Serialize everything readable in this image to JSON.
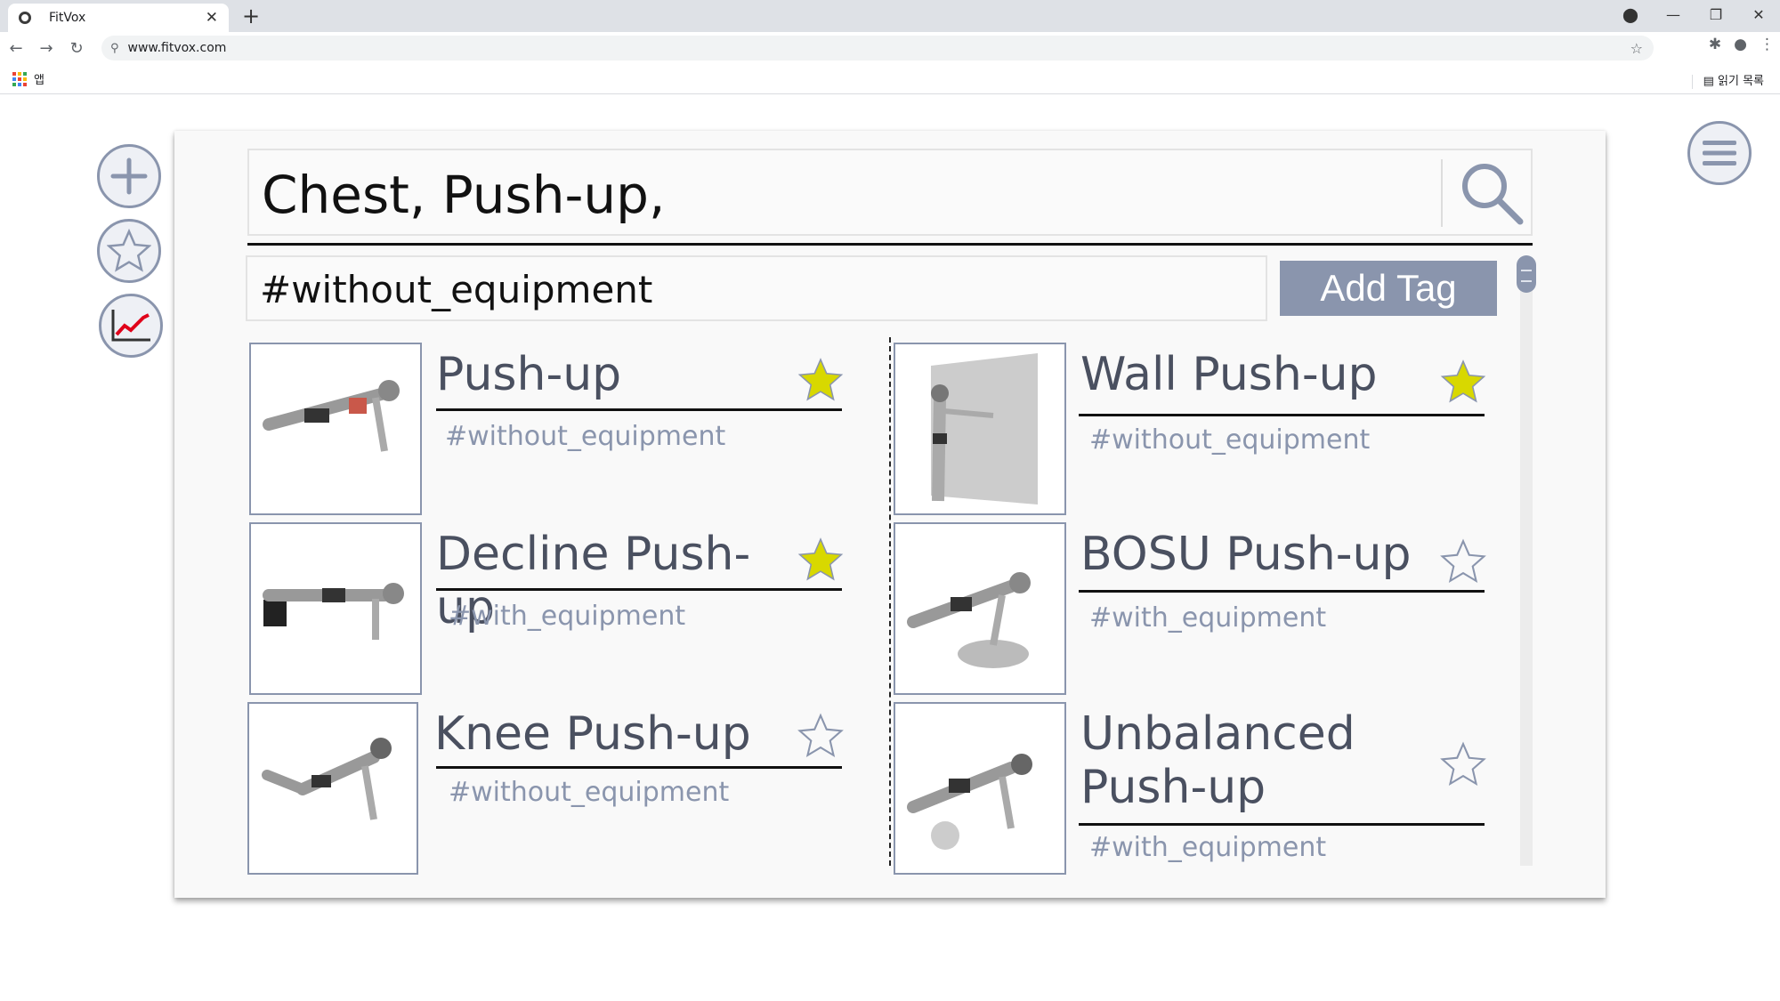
{
  "browser": {
    "tab_title": "FitVox",
    "new_tab": "+",
    "url": "www.fitvox.com",
    "apps_label": "앱",
    "reading_list": "읽기 목록"
  },
  "colors": {
    "accent": "#8a95ad",
    "star_filled": "#d8d800",
    "trend": "#e0001a"
  },
  "side_buttons": [
    {
      "name": "add",
      "icon": "plus-icon"
    },
    {
      "name": "favorites",
      "icon": "star-outline-icon"
    },
    {
      "name": "progress",
      "icon": "line-chart-icon"
    }
  ],
  "menu_icon": "hamburger-menu-icon",
  "search": {
    "query": "Chest, Push-up,",
    "icon": "search-icon"
  },
  "tag_input": {
    "value": "#without_equipment"
  },
  "add_tag_button": "Add Tag",
  "exercises": [
    {
      "name": "Push-up",
      "tag": "#without_equipment",
      "favorite": true
    },
    {
      "name": "Wall Push-up",
      "tag": "#without_equipment",
      "favorite": true
    },
    {
      "name": "Decline Push-up",
      "tag": "#with_equipment",
      "favorite": true
    },
    {
      "name": "BOSU Push-up",
      "tag": "#with_equipment",
      "favorite": false
    },
    {
      "name": "Knee Push-up",
      "tag": "#without_equipment",
      "favorite": false
    },
    {
      "name": "Unbalanced Push-up",
      "tag": "#with_equipment",
      "favorite": false
    }
  ]
}
